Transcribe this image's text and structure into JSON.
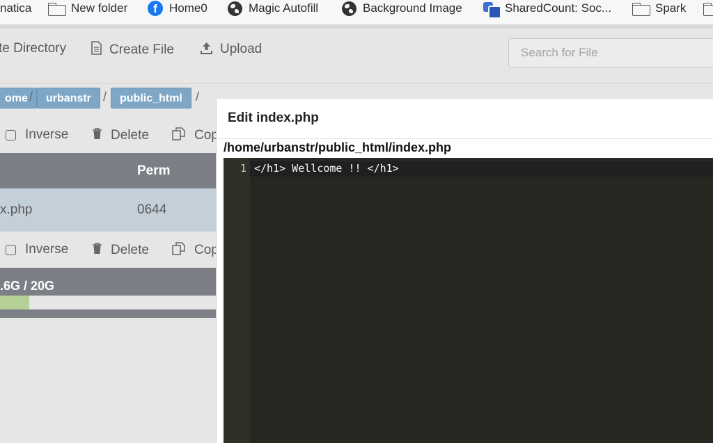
{
  "bookmarks": [
    {
      "label": "natica",
      "icon": "none"
    },
    {
      "label": "New folder",
      "icon": "folder-icon"
    },
    {
      "label": "Home0",
      "icon": "facebook-icon"
    },
    {
      "label": "Magic Autofill",
      "icon": "globe-icon"
    },
    {
      "label": "Background Image",
      "icon": "globe-icon"
    },
    {
      "label": "SharedCount: Soc...",
      "icon": "sharedcount-icon"
    },
    {
      "label": "Spark",
      "icon": "folder-icon"
    },
    {
      "label": "",
      "icon": "folder-icon"
    }
  ],
  "toolbar": {
    "create_directory": "te Directory",
    "create_file": "Create File",
    "upload": "Upload",
    "search_placeholder": "Search for File"
  },
  "breadcrumb": [
    "ome",
    "urbanstr",
    "public_html"
  ],
  "breadcrumb_separator": "/",
  "actions": {
    "inverse": "Inverse",
    "delete": "Delete",
    "copy": "Cop"
  },
  "table": {
    "headers": {
      "perm": "Perm"
    },
    "rows": [
      {
        "name": "x.php",
        "perm": "0644"
      }
    ]
  },
  "storage": {
    "text": ".6G / 20G",
    "used_fraction": 0.03,
    "bar_color": "#b6d196"
  },
  "modal": {
    "title": "Edit index.php",
    "path": "/home/urbanstr/public_html/index.php",
    "editor": {
      "line_number": "1",
      "code": "</h1> Wellcome !! </h1>"
    }
  },
  "colors": {
    "crumb": "#7ea6c7",
    "table_header": "#7c7f86",
    "selected_row": "#c3cfd9",
    "editor_bg": "#272822"
  }
}
